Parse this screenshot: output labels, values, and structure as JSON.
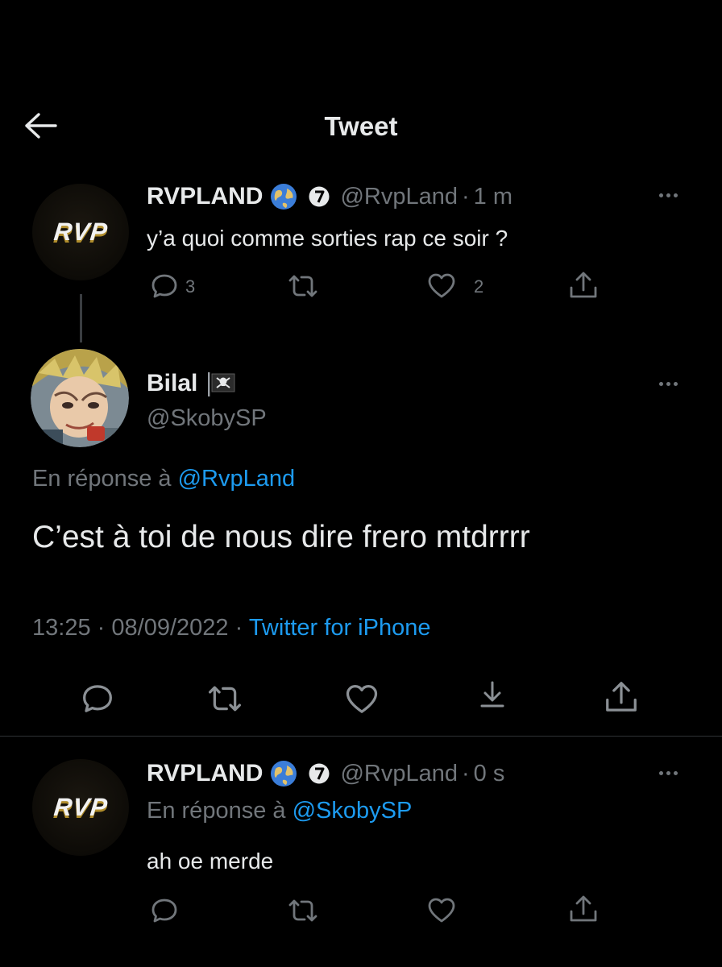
{
  "header": {
    "title": "Tweet"
  },
  "tweet1": {
    "name": "RVPLAND",
    "handle": "@RvpLand",
    "separator": "·",
    "time": "1 m",
    "avatar_text": "RVP",
    "text": "y’a quoi comme sorties rap ce soir ?",
    "replies": "3",
    "likes": "2"
  },
  "tweet2": {
    "name": "Bilal",
    "handle": "@SkobySP",
    "reply_prefix": "En réponse à",
    "reply_to": "@RvpLand",
    "text": "C’est à toi de nous dire frero mtdrrrr",
    "time": "13:25",
    "sep1": "·",
    "date": "08/09/2022",
    "sep2": "·",
    "source": "Twitter for iPhone"
  },
  "tweet3": {
    "name": "RVPLAND",
    "handle": "@RvpLand",
    "separator": "·",
    "time": "0 s",
    "avatar_text": "RVP",
    "reply_prefix": "En réponse à",
    "reply_to": "@SkobySP",
    "text": "ah oe merde"
  },
  "colors": {
    "background": "#000000",
    "text": "#e7e9ea",
    "secondary": "#71767b",
    "link": "#1d9bf0",
    "divider": "#2f3336"
  },
  "icons": [
    "back-arrow-icon",
    "globe-icon",
    "affiliate-badge-icon",
    "more-icon",
    "reply-icon",
    "retweet-icon",
    "like-icon",
    "share-icon",
    "bookmark-icon",
    "pirate-flag-icon"
  ]
}
